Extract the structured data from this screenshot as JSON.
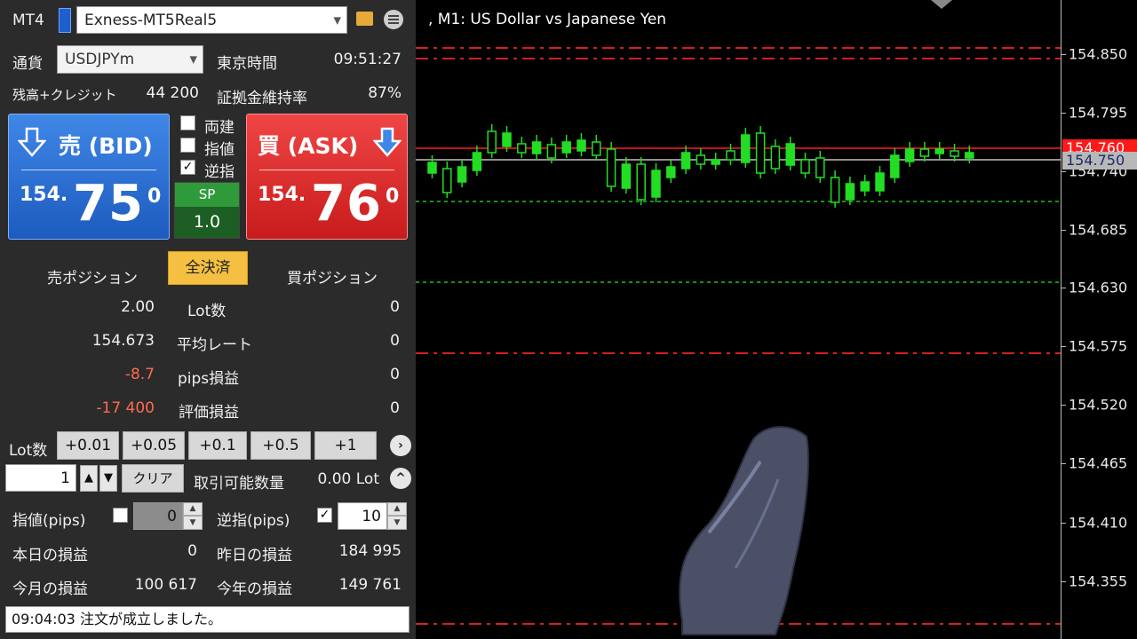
{
  "header": {
    "platform_label": "MT4",
    "account": "Exness-MT5Real5"
  },
  "info": {
    "currency_label": "通貨",
    "symbol": "USDJPYm",
    "time_label": "東京時間",
    "time": "09:51:27",
    "balance_label": "残高+クレジット",
    "balance": "44 200",
    "margin_label": "証拠金維持率",
    "margin": "87%"
  },
  "sell": {
    "header": "売 (BID)",
    "prefix": "154.",
    "main": "75",
    "sup": "0"
  },
  "buy": {
    "header": "買 (ASK)",
    "prefix": "154.",
    "main": "76",
    "sup": "0"
  },
  "options": {
    "hedge": "両建",
    "limit": "指値",
    "stop": "逆指",
    "hedge_checked": false,
    "limit_checked": false,
    "stop_checked": true,
    "check_mark": "✓"
  },
  "spread": {
    "label": "SP",
    "value": "1.0"
  },
  "positions": {
    "sell_title": "売ポジション",
    "close_all": "全決済",
    "buy_title": "買ポジション",
    "rows": [
      {
        "label": "Lot数",
        "sell": "2.00",
        "buy": "0"
      },
      {
        "label": "平均レート",
        "sell": "154.673",
        "buy": "0"
      },
      {
        "label": "pips損益",
        "sell": "-8.7",
        "buy": "0"
      },
      {
        "label": "評価損益",
        "sell": "-17 400",
        "buy": "0"
      }
    ]
  },
  "lot": {
    "label": "Lot数",
    "increments": [
      "+0.01",
      "+0.05",
      "+0.1",
      "+0.5",
      "+1"
    ],
    "more": "›",
    "value": "1",
    "up": "▲",
    "down": "▼",
    "clear": "クリア",
    "available_label": "取引可能数量",
    "available": "0.00 Lot",
    "collapse": "^"
  },
  "pips": {
    "limit_label": "指値(pips)",
    "limit_value": "0",
    "stop_label": "逆指(pips)",
    "stop_value": "10",
    "spin_up": "▲",
    "spin_down": "▼"
  },
  "pnl": {
    "today_label": "本日の損益",
    "today": "0",
    "yesterday_label": "昨日の損益",
    "yesterday": "184 995",
    "month_label": "今月の損益",
    "month": "100 617",
    "year_label": "今年の損益",
    "year": "149 761"
  },
  "status_message": "09:04:03 注文が成立しました。",
  "chart": {
    "title": ", M1:  US Dollar vs Japanese Yen",
    "price_labels": [
      "154.850",
      "154.795",
      "154.740",
      "154.685",
      "154.630",
      "154.575",
      "154.520",
      "154.465",
      "154.410",
      "154.355"
    ],
    "ask_badge": "154.760",
    "bid_badge": "154.750",
    "colors": {
      "ask_line": "#ff1a1a",
      "bid_line": "#c0c0c0",
      "green_level": "#19c819",
      "red_level": "#d42020",
      "candle": "#22dd22"
    }
  }
}
